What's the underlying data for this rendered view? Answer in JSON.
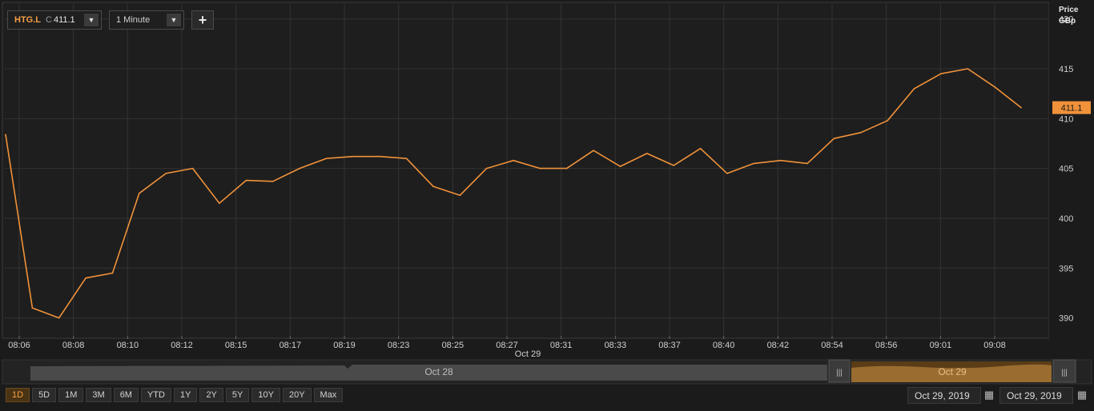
{
  "toolbar": {
    "symbol": "HTG.L",
    "close_prefix": "C",
    "close_value": "411.1",
    "interval": "1 Minute",
    "add_label": "+"
  },
  "price_axis": {
    "title_line1": "Price",
    "title_line2": "GBp",
    "last_price_tag": "411.1"
  },
  "navigator": {
    "left_label": "Oct 28",
    "right_label": "Oct 29"
  },
  "range_buttons": [
    "1D",
    "5D",
    "1M",
    "3M",
    "6M",
    "YTD",
    "1Y",
    "2Y",
    "5Y",
    "10Y",
    "20Y",
    "Max"
  ],
  "active_range": "1D",
  "date_from": "Oct 29, 2019",
  "date_to": "Oct 29, 2019",
  "colors": {
    "line": "#f0923a",
    "background": "#1b1b1b",
    "grid": "#333333",
    "tag": "#f0923a"
  },
  "chart_data": {
    "type": "line",
    "title": "",
    "xlabel": "",
    "ylabel": "Price GBp",
    "ylim": [
      388.2,
      421.5
    ],
    "yticks": [
      390,
      395,
      400,
      405,
      410,
      415,
      420
    ],
    "grid": true,
    "x_tick_labels": [
      "08:06",
      "08:08",
      "08:10",
      "08:12",
      "08:15",
      "08:17",
      "08:19",
      "08:23",
      "08:25",
      "08:27",
      "08:31",
      "08:33",
      "08:37",
      "08:40",
      "08:42",
      "08:54",
      "08:56",
      "09:01",
      "09:08"
    ],
    "date_marker": "Oct 29",
    "series": [
      {
        "values": [
          408.4,
          391.0,
          390.0,
          394.0,
          394.5,
          402.5,
          404.5,
          405.0,
          401.5,
          403.8,
          403.7,
          405.0,
          406.0,
          406.2,
          406.2,
          406.0,
          403.2,
          402.3,
          405.0,
          405.8,
          405.0,
          405.0,
          406.8,
          405.2,
          406.5,
          405.3,
          407.0,
          404.5,
          405.5,
          405.8,
          405.5,
          408.0,
          408.6,
          409.8,
          413.0,
          414.5,
          415.0,
          413.2,
          411.1
        ]
      }
    ]
  }
}
